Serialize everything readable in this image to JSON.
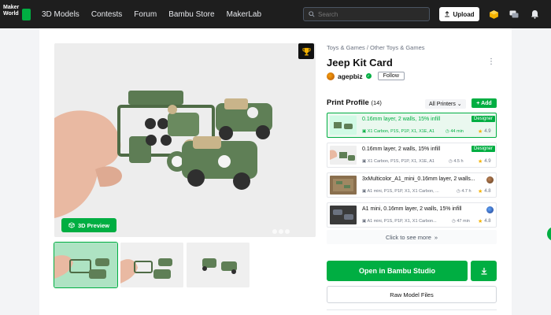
{
  "nav": {
    "logo_line1": "Maker",
    "logo_line2": "World",
    "items": [
      "3D Models",
      "Contests",
      "Forum",
      "Bambu Store",
      "MakerLab"
    ],
    "search_placeholder": "Search",
    "upload_label": "Upload",
    "icons": [
      "cube-icon",
      "chat-icon",
      "bell-icon"
    ]
  },
  "model": {
    "breadcrumb": "Toys & Games / Other Toys & Games",
    "title": "Jeep Kit Card",
    "author": "agepbiz",
    "follow_label": "Follow",
    "preview_label": "3D Preview"
  },
  "print_profile": {
    "title": "Print Profile",
    "count": "(14)",
    "filter_label": "All Printers",
    "add_label": "+ Add",
    "more_label": "Click to see more",
    "items": [
      {
        "name": "0.16mm layer, 2 walls, 15% infill",
        "printers": "X1 Carbon, P1S, P1P, X1, X1E, A1",
        "time": "44 min",
        "rating": "4.9",
        "badge": "Designer",
        "selected": true
      },
      {
        "name": "0.16mm layer, 2 walls, 15% infill",
        "printers": "X1 Carbon, P1S, P1P, X1, X1E, A1",
        "time": "4.5 h",
        "rating": "4.9",
        "badge": "Designer",
        "selected": false
      },
      {
        "name": "3xMulticolor_A1_mini_0.16mm layer, 2 walls...",
        "printers": "A1 mini, P1S, P1P, X1, X1 Carbon, ...",
        "time": "4.7 h",
        "rating": "4.8",
        "badge": "",
        "selected": false
      },
      {
        "name": "A1 mini, 0.16mm layer, 2 walls, 15% infill",
        "printers": "A1 mini, P1S, P1P, X1, X1 Carbon...",
        "time": "47 min",
        "rating": "4.8",
        "badge": "",
        "selected": false
      }
    ]
  },
  "actions": {
    "open_label": "Open in Bambu Studio",
    "raw_label": "Raw Model Files"
  },
  "colors": {
    "accent": "#00ae42",
    "topbar": "#1e1e1e"
  }
}
